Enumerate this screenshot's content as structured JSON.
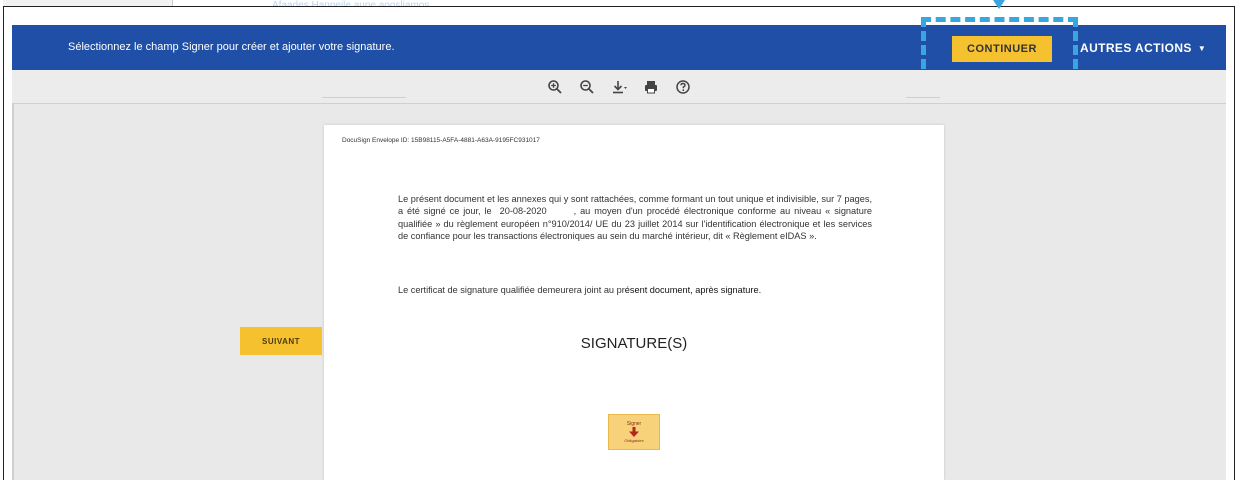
{
  "overlay": {
    "faint_text": "Afaades Hanpeile aupe aoosliamos",
    "highlight_color": "#3aa6e0"
  },
  "header": {
    "instruction": "Sélectionnez le champ Signer pour créer et ajouter votre signature.",
    "continue_label": "CONTINUER",
    "more_actions_label": "AUTRES ACTIONS",
    "bar_color": "#1f4fa6",
    "button_color": "#f5c12e"
  },
  "toolbar": {
    "icons": [
      "zoom-in-icon",
      "zoom-out-icon",
      "download-icon",
      "print-icon",
      "help-icon"
    ]
  },
  "navigation": {
    "next_label": "SUIVANT"
  },
  "document": {
    "envelope_id": "DocuSign Envelope ID: 15B98115-A5FA-4881-A63A-9195FC931017",
    "paragraph_start": "Le présent document et les annexes qui y sont rattachées, comme formant un tout unique et indivisible, sur 7 pages, a été signé ce jour, le ",
    "date": "20-08-2020",
    "paragraph_end": ", au moyen d'un procédé électronique conforme au niveau « signature qualifiée » du règlement européen n°910/2014/ UE du 23 juillet 2014 sur l'identification électronique et les services de confiance pour les transactions électroniques au sein du marché intérieur, dit « Règlement eIDAS ».",
    "certificate_start": "Le certificat de signature qualifiée demeurera joint au pr",
    "certificate_bold": "ésent document, après signature.",
    "signatures_title": "SIGNATURE(S)",
    "sign_field_label": "Signer",
    "sign_field_sub": "Obligatoire"
  }
}
